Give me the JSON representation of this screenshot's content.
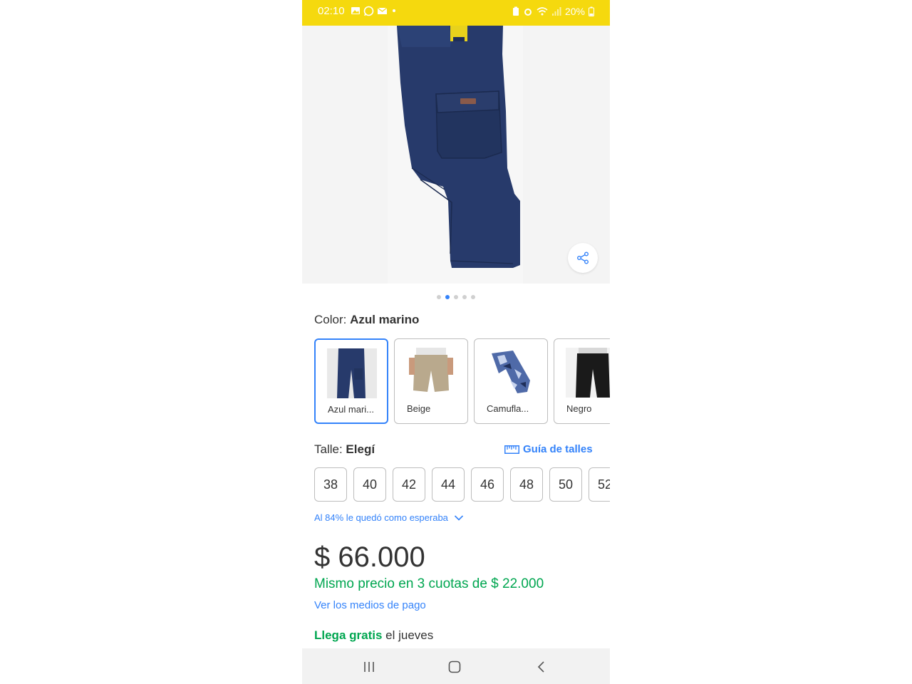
{
  "status_bar": {
    "time": "02:10",
    "battery": "20%",
    "left_icons": [
      "gallery-icon",
      "whatsapp-icon",
      "mail-icon",
      "dot-icon"
    ],
    "right_icons": [
      "battery-saver-icon",
      "alarm-icon",
      "wifi-icon",
      "signal-icon",
      "battery-icon"
    ]
  },
  "colors": {
    "status_bar_bg": "#f5d90e",
    "accent_blue": "#3483fa",
    "accent_green": "#00a650",
    "product_navy": "#273a6b"
  },
  "gallery": {
    "total_images": 5,
    "active_index": 1
  },
  "color_selector": {
    "label": "Color: ",
    "value": "Azul marino",
    "options": [
      {
        "label": "Azul mari...",
        "selected": true
      },
      {
        "label": "Beige",
        "selected": false
      },
      {
        "label": "Camufla...",
        "selected": false
      },
      {
        "label": "Negro",
        "selected": false
      }
    ]
  },
  "size_selector": {
    "label": "Talle: ",
    "value": "Elegí",
    "guide_label": "Guía de talles",
    "sizes": [
      "38",
      "40",
      "42",
      "44",
      "46",
      "48",
      "50",
      "52"
    ]
  },
  "fit_note": "Al 84% le quedó como esperaba",
  "pricing": {
    "price": "$ 66.000",
    "installments": "Mismo precio en 3 cuotas de $ 22.000",
    "payment_methods_link": "Ver los medios de pago"
  },
  "shipping": {
    "free_label": "Llega gratis",
    "day_label": " el jueves"
  },
  "nav_bar": {
    "buttons": [
      "recents-icon",
      "home-icon",
      "back-icon"
    ]
  }
}
